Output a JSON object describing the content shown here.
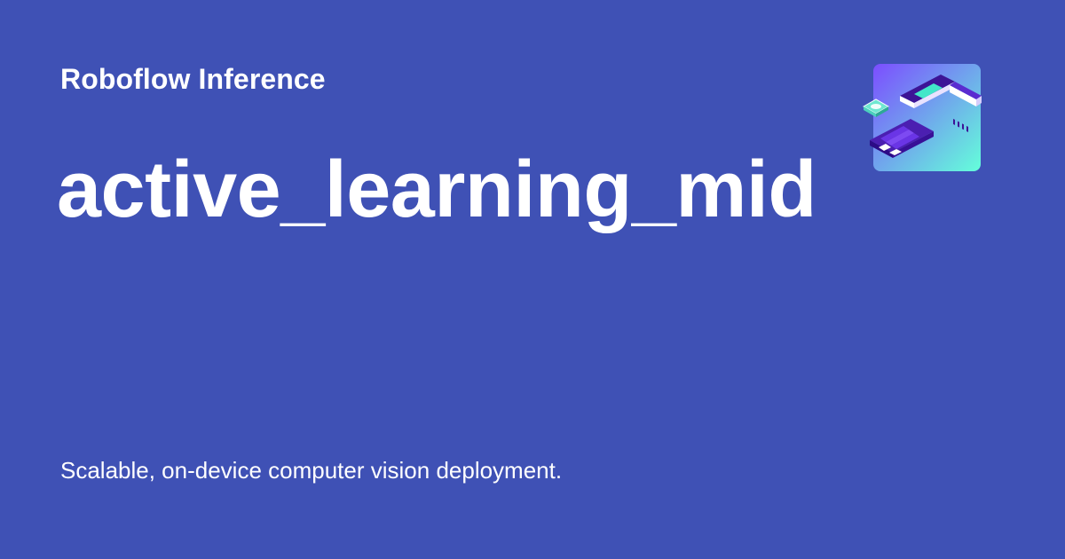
{
  "header": {
    "site_title": "Roboflow Inference"
  },
  "main": {
    "page_title": "active_learning_mid",
    "tagline": "Scalable, on-device computer vision deployment."
  },
  "logo": {
    "icon": "roboflow-inference-hardware-icon"
  },
  "colors": {
    "background": "#3f51b5",
    "text": "#ffffff",
    "logo_gradient_start": "#7c4dff",
    "logo_gradient_end": "#64ffda"
  }
}
